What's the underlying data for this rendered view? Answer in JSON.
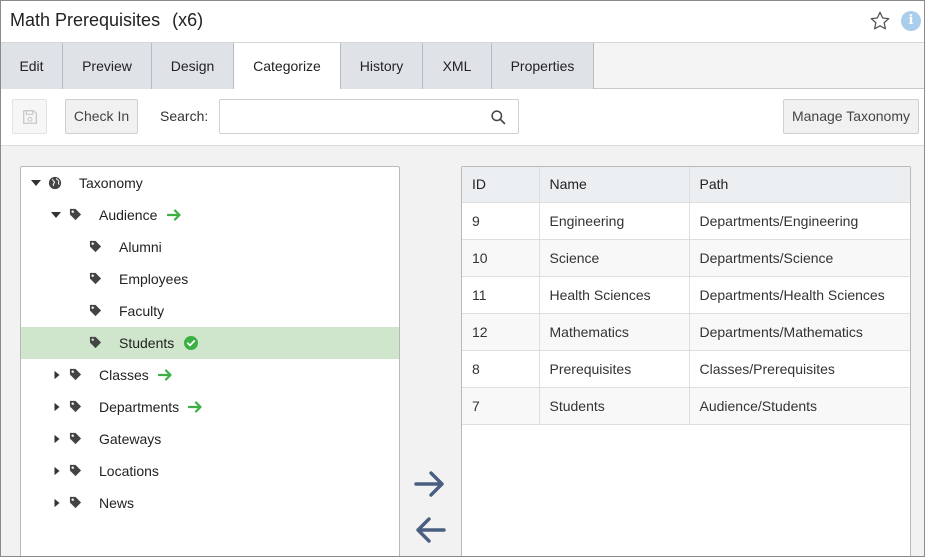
{
  "header": {
    "title": "Math Prerequisites",
    "count": "(x6)"
  },
  "tabs": [
    {
      "label": "Edit"
    },
    {
      "label": "Preview"
    },
    {
      "label": "Design"
    },
    {
      "label": "Categorize"
    },
    {
      "label": "History"
    },
    {
      "label": "XML"
    },
    {
      "label": "Properties"
    }
  ],
  "active_tab": "Categorize",
  "toolbar": {
    "checkin_label": "Check In",
    "search_label": "Search:",
    "search_value": "",
    "manage_label": "Manage Taxonomy"
  },
  "tree": {
    "root": "Taxonomy",
    "items": [
      {
        "label": "Audience"
      },
      {
        "label": "Alumni"
      },
      {
        "label": "Employees"
      },
      {
        "label": "Faculty"
      },
      {
        "label": "Students"
      },
      {
        "label": "Classes"
      },
      {
        "label": "Departments"
      },
      {
        "label": "Gateways"
      },
      {
        "label": "Locations"
      },
      {
        "label": "News"
      }
    ],
    "selected": "Students"
  },
  "grid": {
    "columns": [
      "ID",
      "Name",
      "Path"
    ],
    "rows": [
      {
        "id": "9",
        "name": "Engineering",
        "path": "Departments/Engineering"
      },
      {
        "id": "10",
        "name": "Science",
        "path": "Departments/Science"
      },
      {
        "id": "11",
        "name": "Health Sciences",
        "path": "Departments/Health Sciences"
      },
      {
        "id": "12",
        "name": "Mathematics",
        "path": "Departments/Mathematics"
      },
      {
        "id": "8",
        "name": "Prerequisites",
        "path": "Classes/Prerequisites"
      },
      {
        "id": "7",
        "name": "Students",
        "path": "Audience/Students"
      }
    ]
  },
  "colors": {
    "accent_green": "#3cb043",
    "selected_row": "#cfe6cc",
    "arrow_blue": "#4a5f80",
    "info_blue": "#a9cdeb"
  }
}
